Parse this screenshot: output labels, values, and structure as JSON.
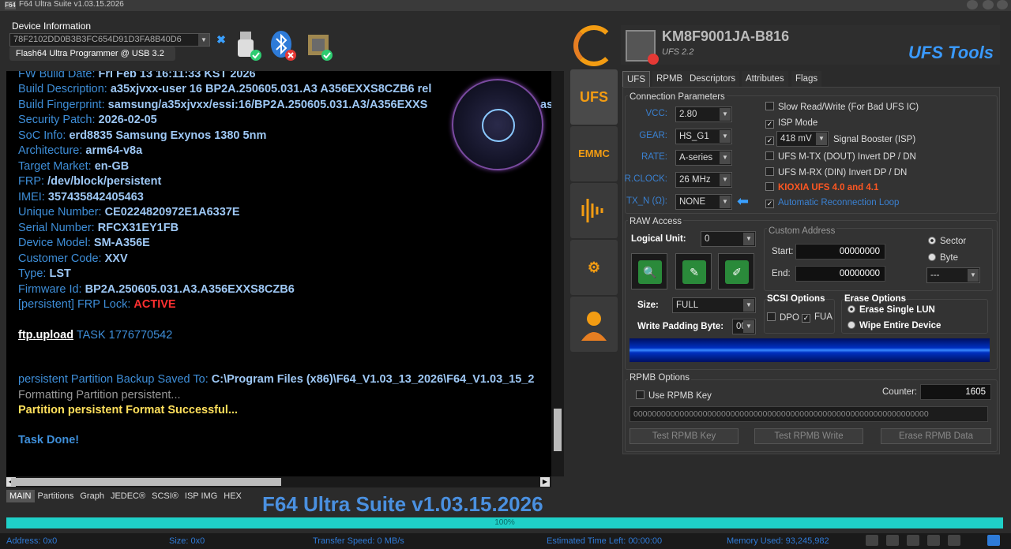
{
  "window": {
    "title": "F64 Ultra Suite v1.03.15.2026",
    "app_icon": "F64"
  },
  "device_info": {
    "label": "Device Information",
    "device_id": "78F2102DD0B3B3FC654D91D3FA8B40D6",
    "programmer": "Flash64 Ultra Programmer @ USB 3.2",
    "icons": [
      "usb-ok-icon",
      "bluetooth-error-icon",
      "chip-ok-icon"
    ]
  },
  "console": {
    "lines": [
      {
        "k": "FW Build Date: ",
        "v": "Fri Feb 13 16:11:33 KST 2026",
        "s": ""
      },
      {
        "k": "Build Description: ",
        "v": "a35xjvxx-user 16 BP2A.250605.031.A3 A356EXXS8CZB6 rel",
        "s": ""
      },
      {
        "k": "Build Fingerprint: ",
        "v": "samsung/a35xjvxx/essi:16/BP2A.250605.031.A3/A356EXXS",
        "s": ""
      },
      {
        "k": "Security Patch: ",
        "v": "2026-02-05",
        "s": ""
      },
      {
        "k": "SoC Info: ",
        "v": "erd8835 Samsung Exynos 1380 5nm",
        "s": ""
      },
      {
        "k": "Architecture: ",
        "v": "arm64-v8a",
        "s": ""
      },
      {
        "k": "Target Market: ",
        "v": "en-GB",
        "s": ""
      },
      {
        "k": "FRP: ",
        "v": "/dev/block/persistent",
        "s": ""
      },
      {
        "k": "IMEI: ",
        "v": "357435842405463",
        "s": ""
      },
      {
        "k": "Unique Number: ",
        "v": "CE0224820972E1A6337E",
        "s": ""
      },
      {
        "k": "Serial Number: ",
        "v": "RFCX31EY1FB",
        "s": ""
      },
      {
        "k": "Device Model: ",
        "v": "SM-A356E",
        "s": ""
      },
      {
        "k": "Customer Code: ",
        "v": "XXV",
        "s": ""
      },
      {
        "k": "Type: ",
        "v": "LST",
        "s": ""
      },
      {
        "k": "Firmware Id: ",
        "v": "BP2A.250605.031.A3.A356EXXS8CZB6",
        "s": ""
      },
      {
        "k": "[persistent] FRP Lock: ",
        "v": "ACTIVE",
        "s": "r"
      }
    ],
    "ftp_cmd": "ftp.upload",
    "ftp_task": " TASK 1776770542",
    "backup_k": "persistent Partition Backup Saved To: ",
    "backup_v": "C:\\Program Files (x86)\\F64_V1.03_13_2026\\F64_V1.03_15_2",
    "formatting": "Formatting Partition persistent...",
    "format_ok": "Partition persistent Format Successful...",
    "done": "Task Done!",
    "overflow_fragment": "as"
  },
  "bottom_tabs": [
    "MAIN",
    "Partitions",
    "Graph",
    "JEDEC®",
    "SCSI®",
    "ISP IMG",
    "HEX"
  ],
  "suite_banner": "F64 Ultra Suite v1.03.15.2026",
  "progress": {
    "value": 1.0,
    "label": "100%"
  },
  "status": {
    "address": "Address: 0x0",
    "size": "Size: 0x0",
    "speed": "Transfer Speed: 0 MB/s",
    "eta": "Estimated Time Left: 00:00:00",
    "memory": "Memory Used: 93,245,982"
  },
  "sidebar": [
    "UFS",
    "EMMC",
    "Signal",
    "Settings",
    "User"
  ],
  "header": {
    "chip": "KM8F9001JA-B816",
    "ufs_version": "UFS 2.2",
    "tools_title": "UFS Tools"
  },
  "tabs": [
    "UFS",
    "RPMB",
    "Descriptors",
    "Attributes",
    "Flags"
  ],
  "conn": {
    "title": "Connection Parameters",
    "vcc_label": "VCC:",
    "vcc": "2.80",
    "gear_label": "GEAR:",
    "gear": "HS_G1",
    "rate_label": "RATE:",
    "rate": "A-series",
    "rclock_label": "R.CLOCK:",
    "rclock": "26 MHz",
    "txn_label": "TX_N (Ω):",
    "txn": "NONE"
  },
  "options": {
    "slow": "Slow Read/Write (For Bad UFS IC)",
    "isp": "ISP Mode",
    "boost_val": "418 mV",
    "boost": "Signal Booster (ISP)",
    "mtx": "UFS M-TX (DOUT) Invert DP / DN",
    "mrx": "UFS M-RX (DIN) Invert DP / DN",
    "kioxia": "KIOXIA UFS 4.0 and 4.1",
    "reconnect": "Automatic Reconnection Loop"
  },
  "raw": {
    "title": "RAW Access",
    "lun_label": "Logical Unit:",
    "lun": "0",
    "size_label": "Size:",
    "size": "FULL",
    "pad_label": "Write Padding Byte:",
    "pad": "00",
    "custom_title": "Custom Address",
    "start_label": "Start:",
    "start": "00000000",
    "end_label": "End:",
    "end": "00000000",
    "sector": "Sector",
    "byte": "Byte",
    "unit_sel": "---",
    "scsi_title": "SCSI Options",
    "dpo": "DPO",
    "fua": "FUA",
    "erase_title": "Erase Options",
    "erase_lun": "Erase Single LUN",
    "wipe": "Wipe Entire Device"
  },
  "rpmb": {
    "title": "RPMB Options",
    "use_key": "Use RPMB Key",
    "counter_label": "Counter:",
    "counter": "1605",
    "key": "0000000000000000000000000000000000000000000000000000000000000000",
    "test_key": "Test RPMB Key",
    "test_write": "Test RPMB Write",
    "erase": "Erase RPMB Data"
  }
}
